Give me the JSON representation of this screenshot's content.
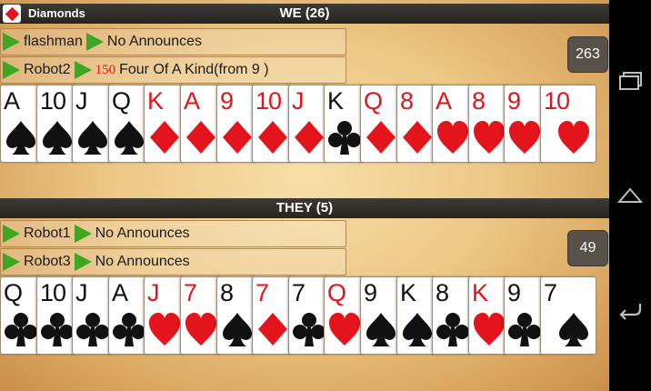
{
  "trump": {
    "label": "Diamonds",
    "icon": "diamond-icon",
    "color": "#e3141b"
  },
  "teams": [
    {
      "title": "WE (26)",
      "score": "263",
      "players": [
        {
          "name": "flashman",
          "announce": "No Announces",
          "bonus": ""
        },
        {
          "name": "Robot2",
          "announce": "Four Of A Kind(from 9 )",
          "bonus": "150"
        }
      ],
      "cards": [
        {
          "rank": "A",
          "suit": "spade"
        },
        {
          "rank": "10",
          "suit": "spade"
        },
        {
          "rank": "J",
          "suit": "spade"
        },
        {
          "rank": "Q",
          "suit": "spade"
        },
        {
          "rank": "K",
          "suit": "diamond"
        },
        {
          "rank": "A",
          "suit": "diamond"
        },
        {
          "rank": "9",
          "suit": "diamond"
        },
        {
          "rank": "10",
          "suit": "diamond"
        },
        {
          "rank": "J",
          "suit": "diamond"
        },
        {
          "rank": "K",
          "suit": "club"
        },
        {
          "rank": "Q",
          "suit": "diamond"
        },
        {
          "rank": "8",
          "suit": "diamond"
        },
        {
          "rank": "A",
          "suit": "heart"
        },
        {
          "rank": "8",
          "suit": "heart"
        },
        {
          "rank": "9",
          "suit": "heart"
        },
        {
          "rank": "10",
          "suit": "heart"
        }
      ]
    },
    {
      "title": "THEY (5)",
      "score": "49",
      "players": [
        {
          "name": "Robot1",
          "announce": "No Announces",
          "bonus": ""
        },
        {
          "name": "Robot3",
          "announce": "No Announces",
          "bonus": ""
        }
      ],
      "cards": [
        {
          "rank": "Q",
          "suit": "club"
        },
        {
          "rank": "10",
          "suit": "club"
        },
        {
          "rank": "J",
          "suit": "club"
        },
        {
          "rank": "A",
          "suit": "club"
        },
        {
          "rank": "J",
          "suit": "heart"
        },
        {
          "rank": "7",
          "suit": "heart"
        },
        {
          "rank": "8",
          "suit": "spade"
        },
        {
          "rank": "7",
          "suit": "diamond"
        },
        {
          "rank": "7",
          "suit": "club"
        },
        {
          "rank": "Q",
          "suit": "heart"
        },
        {
          "rank": "9",
          "suit": "spade"
        },
        {
          "rank": "K",
          "suit": "spade"
        },
        {
          "rank": "8",
          "suit": "club"
        },
        {
          "rank": "K",
          "suit": "heart"
        },
        {
          "rank": "9",
          "suit": "club"
        },
        {
          "rank": "7",
          "suit": "spade"
        }
      ]
    }
  ],
  "system_nav": {
    "buttons": [
      "recent-apps-icon",
      "home-icon",
      "back-icon"
    ]
  }
}
